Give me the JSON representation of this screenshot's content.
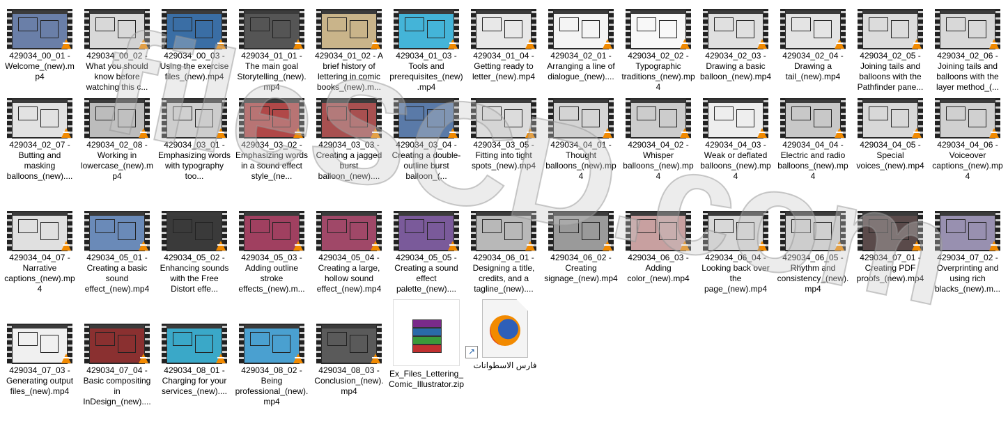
{
  "watermark": "fileSCD.com",
  "files": [
    {
      "label": "429034_00_01 - Welcome_(new).mp4",
      "bg": "#6a7fa8"
    },
    {
      "label": "429034_00_02 - What you should know before watching this c...",
      "bg": "#d8d8d8"
    },
    {
      "label": "429034_00_03 - Using the exercise files_(new).mp4",
      "bg": "#3a6ea5"
    },
    {
      "label": "429034_01_01 - The main goal Storytelling_(new).mp4",
      "bg": "#555555"
    },
    {
      "label": "429034_01_02 - A brief history of lettering in comic books_(new).m...",
      "bg": "#c9b48a"
    },
    {
      "label": "429034_01_03 - Tools and prerequisites_(new).mp4",
      "bg": "#44b4d8"
    },
    {
      "label": "429034_01_04 - Getting ready to letter_(new).mp4",
      "bg": "#e8e8e8"
    },
    {
      "label": "429034_02_01 - Arranging a line of dialogue_(new)....",
      "bg": "#f4f4f4"
    },
    {
      "label": "429034_02_02 - Typographic traditions_(new).mp4",
      "bg": "#f8f8f8"
    },
    {
      "label": "429034_02_03 - Drawing a basic balloon_(new).mp4",
      "bg": "#e0e0e0"
    },
    {
      "label": "429034_02_04 - Drawing a tail_(new).mp4",
      "bg": "#e4e4e4"
    },
    {
      "label": "429034_02_05 - Joining tails and balloons with the Pathfinder pane...",
      "bg": "#dcdcdc"
    },
    {
      "label": "429034_02_06 - Joining tails and balloons with the layer method_(...",
      "bg": "#d8d8d8"
    },
    {
      "label": "429034_02_07 - Butting and masking balloons_(new)....",
      "bg": "#e2e2e2"
    },
    {
      "label": "429034_02_08 - Working in lowercase_(new).mp4",
      "bg": "#bcbcbc"
    },
    {
      "label": "429034_03_01 - Emphasizing words with typography too...",
      "bg": "#d0d0d0"
    },
    {
      "label": "429034_03_02 - Emphasizing words in a sound effect style_(ne...",
      "bg": "#b04848"
    },
    {
      "label": "429034_03_03 - Creating a jagged burst balloon_(new)....",
      "bg": "#a85050"
    },
    {
      "label": "429034_03_04 - Creating a double-outline burst balloon_(...",
      "bg": "#5a7aa8"
    },
    {
      "label": "429034_03_05 - Fitting into tight spots_(new).mp4",
      "bg": "#dcdcdc"
    },
    {
      "label": "429034_04_01 - Thought balloons_(new).mp4",
      "bg": "#d4d4d4"
    },
    {
      "label": "429034_04_02 - Whisper balloons_(new).mp4",
      "bg": "#cccccc"
    },
    {
      "label": "429034_04_03 - Weak or deflated balloons_(new).mp4",
      "bg": "#eeeeee"
    },
    {
      "label": "429034_04_04 - Electric and radio balloons_(new).mp4",
      "bg": "#c8c8c8"
    },
    {
      "label": "429034_04_05 - Special voices_(new).mp4",
      "bg": "#d8d8d8"
    },
    {
      "label": "429034_04_06 - Voiceover captions_(new).mp4",
      "bg": "#d0d0d0"
    },
    {
      "label": "429034_04_07 - Narrative captions_(new).mp4",
      "bg": "#e0e0e0"
    },
    {
      "label": "429034_05_01 - Creating a basic sound effect_(new).mp4",
      "bg": "#6a8ab8"
    },
    {
      "label": "429034_05_02 - Enhancing sounds with the Free Distort effe...",
      "bg": "#3a3a3a"
    },
    {
      "label": "429034_05_03 - Adding outline stroke effects_(new).m...",
      "bg": "#a04060"
    },
    {
      "label": "429034_05_04 - Creating a large, hollow sound effect_(new).mp4",
      "bg": "#a04868"
    },
    {
      "label": "429034_05_05 - Creating a sound effect palette_(new)....",
      "bg": "#7a5a9a"
    },
    {
      "label": "429034_06_01 - Designing a title, credits, and a tagline_(new)....",
      "bg": "#b8b8b8"
    },
    {
      "label": "429034_06_02 - Creating signage_(new).mp4",
      "bg": "#9a9a9a"
    },
    {
      "label": "429034_06_03 - Adding color_(new).mp4",
      "bg": "#c8a0a0"
    },
    {
      "label": "429034_06_04 - Looking back over the page_(new).mp4",
      "bg": "#d8d8d8"
    },
    {
      "label": "429034_06_05 - Rhythm and consistency_(new).mp4",
      "bg": "#d0d0d0"
    },
    {
      "label": "429034_07_01 - Creating PDF proofs_(new).mp4",
      "bg": "#5a4a4a"
    },
    {
      "label": "429034_07_02 - Overprinting and using rich blacks_(new).m...",
      "bg": "#9890b0"
    },
    {
      "label": "429034_07_03 - Generating output files_(new).mp4",
      "bg": "#f0f0f0"
    },
    {
      "label": "429034_07_04 - Basic compositing in InDesign_(new)....",
      "bg": "#8a3030"
    },
    {
      "label": "429034_08_01 - Charging for your services_(new)....",
      "bg": "#3aa8c8"
    },
    {
      "label": "429034_08_02 - Being professional_(new).mp4",
      "bg": "#4aa0d0"
    },
    {
      "label": "429034_08_03 - Conclusion_(new).mp4",
      "bg": "#5a5a5a"
    }
  ],
  "zip": {
    "label": "Ex_Files_Lettering_Comic_Illustrator.zip"
  },
  "shortcut": {
    "label": "فارس الاسطوانات"
  }
}
